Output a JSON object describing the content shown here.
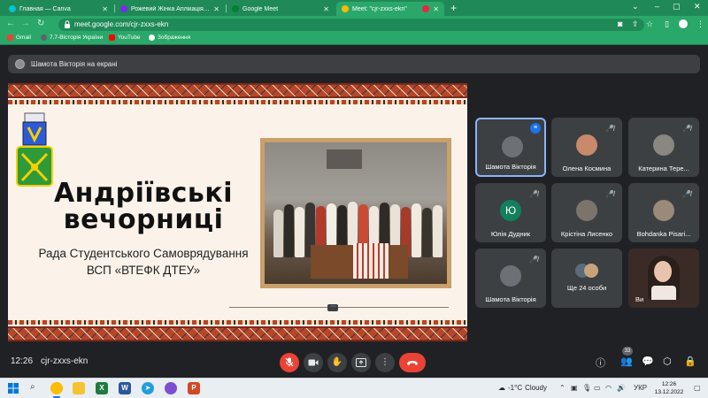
{
  "browser": {
    "tabs": [
      {
        "label": "Главная — Canva",
        "color": "#00c4cc"
      },
      {
        "label": "Рожевий Жінка Аплікація Колл",
        "color": "#7d2ae8"
      },
      {
        "label": "Google Meet",
        "color": "#00832d"
      },
      {
        "label": "Meet: \"cjr-zxxs-ekn\"",
        "color": "#00832d"
      }
    ],
    "url": "meet.google.com/cjr-zxxs-ekn",
    "bookmarks": [
      {
        "label": "Gmail",
        "color": "#ea4335"
      },
      {
        "label": "7.7-Вісторія України",
        "color": "#5f6368"
      },
      {
        "label": "YouTube",
        "color": "#ff0000"
      },
      {
        "label": "Зображення",
        "color": "#ffffff"
      }
    ]
  },
  "meet": {
    "presenting_banner": "Шамота Вікторія на екрані",
    "slide": {
      "title_line1": "Андріївські",
      "title_line2": "вечорниці",
      "subtitle_line1": "Рада Студентського Самоврядування",
      "subtitle_line2": "ВСП «ВТЕФК ДТЕУ»"
    },
    "participants": [
      {
        "name": "Шамота Вікторія",
        "state": "speaking"
      },
      {
        "name": "Олена Космина",
        "state": "muted"
      },
      {
        "name": "Катерина Тере...",
        "state": "muted"
      },
      {
        "name": "Юлія Дудник",
        "state": "muted",
        "initial": "Ю"
      },
      {
        "name": "Крістіна Лисенко",
        "state": "muted"
      },
      {
        "name": "Bohdanka Pisari...",
        "state": "muted"
      },
      {
        "name": "Шамота Вікторія",
        "state": "muted"
      },
      {
        "name": "Ще 24 особи",
        "state": "group"
      },
      {
        "name": "Ви",
        "state": "self"
      }
    ],
    "time": "12:26",
    "meeting_code": "cjr-zxxs-ekn",
    "people_count": "33"
  },
  "taskbar": {
    "weather_temp": "-1°C",
    "weather_text": "Cloudy",
    "lang": "УКР",
    "time": "12:26",
    "date": "13.12.2022"
  }
}
